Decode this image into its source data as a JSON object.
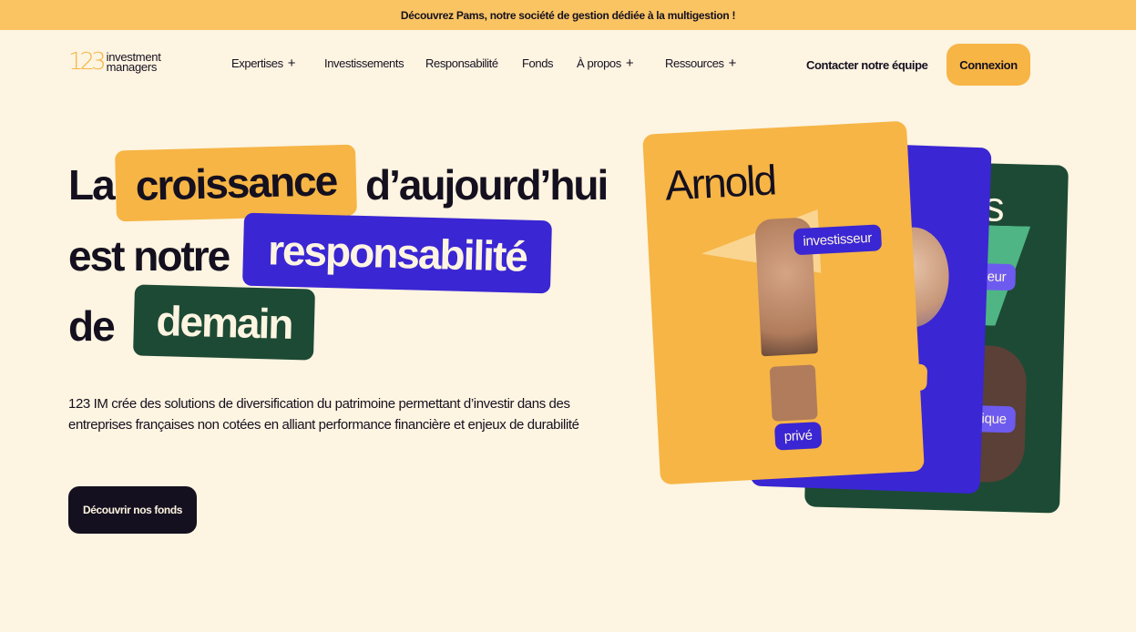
{
  "announcement": "Découvrez Pams, notre société de gestion dédiée à la multigestion !",
  "logo": {
    "mark": "123",
    "line1": "investment",
    "line2": "managers"
  },
  "nav": {
    "items": [
      {
        "label": "Expertises",
        "plus": "+"
      },
      {
        "label": "Investissements"
      },
      {
        "label": "Responsabilité"
      },
      {
        "label": "Fonds"
      },
      {
        "label": "À propos",
        "plus": "+"
      },
      {
        "label": "Ressources",
        "plus": "+"
      }
    ],
    "contact": "Contacter notre équipe",
    "login": "Connexion"
  },
  "hero": {
    "w1": "La",
    "w2": "croissance",
    "w3": "d’aujourd’hui",
    "w4": "est notre",
    "w5": "responsabilité",
    "w6": "de",
    "w7": "demain",
    "description": "123 IM crée des solutions de diversification du patrimoine permettant d’investir dans des entreprises françaises non cotées en alliant performance financière et enjeux de durabilité",
    "cta": "Découvrir nos fonds"
  },
  "cards": {
    "front": {
      "name": "Arnold",
      "tag1": "investisseur",
      "tag2": "privé"
    },
    "middle": {
      "tag1": "me"
    },
    "back": {
      "glyph": "s",
      "tag1": "teur",
      "tag2": "étique"
    }
  },
  "colors": {
    "cream": "#fdf4e1",
    "orange": "#f6b545",
    "blue": "#3a26d3",
    "green": "#1d4a34",
    "ink": "#15101f"
  }
}
